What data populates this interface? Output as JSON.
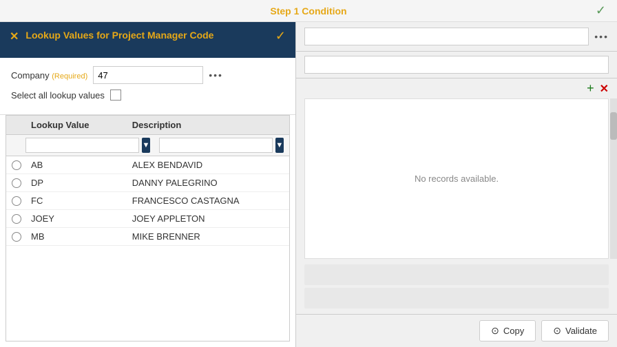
{
  "header": {
    "title": "Step 1 Condition",
    "check_icon": "✓"
  },
  "left_panel": {
    "title": "Lookup Values for Project Manager Code",
    "close_icon": "✕",
    "check_icon": "✓",
    "form": {
      "company_label": "Company",
      "required_label": "(Required)",
      "company_value": "47",
      "more_icon": "•••",
      "select_all_label": "Select all lookup values"
    },
    "table": {
      "col_lookup": "Lookup Value",
      "col_desc": "Description",
      "filter_placeholder_lookup": "",
      "filter_placeholder_desc": "",
      "rows": [
        {
          "lookup": "AB",
          "desc": "ALEX BENDAVID"
        },
        {
          "lookup": "DP",
          "desc": "DANNY PALEGRINO"
        },
        {
          "lookup": "FC",
          "desc": "FRANCESCO CASTAGNA"
        },
        {
          "lookup": "JOEY",
          "desc": "JOEY APPLETON"
        },
        {
          "lookup": "MB",
          "desc": "MIKE BRENNER"
        }
      ]
    }
  },
  "right_panel": {
    "more_icon": "•••",
    "no_records_text": "No records available.",
    "plus_icon": "+",
    "x_icon": "✕",
    "copy_btn": "Copy",
    "validate_btn": "Validate",
    "copy_icon": "⊙",
    "validate_icon": "⊙"
  }
}
